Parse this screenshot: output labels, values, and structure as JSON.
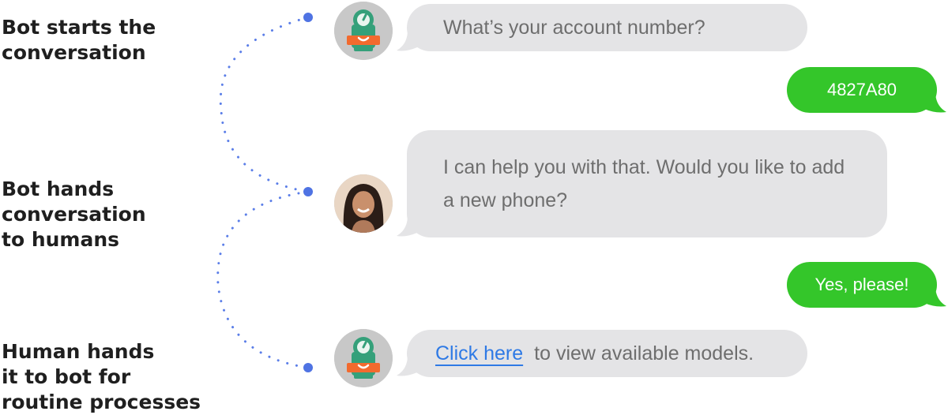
{
  "annotations": [
    {
      "id": "bot-starts",
      "text": "Bot starts the\nconversation"
    },
    {
      "id": "bot-hands",
      "text": "Bot hands\nconversation\nto humans"
    },
    {
      "id": "human-hands",
      "text": "Human hands\nit to bot for\nroutine processes"
    }
  ],
  "messages": [
    {
      "sender": "bot",
      "avatar": "bot-icon",
      "text": "What’s your account number?"
    },
    {
      "sender": "user",
      "text": "4827A80"
    },
    {
      "sender": "human-agent",
      "avatar": "agent-photo",
      "text": "I can help you with that. Would you like to add a new phone?"
    },
    {
      "sender": "user",
      "text": "Yes, please!"
    },
    {
      "sender": "bot",
      "avatar": "bot-icon",
      "link_text": "Click here",
      "text": "to view available models."
    }
  ],
  "colors": {
    "user_bubble": "#34c62a",
    "bot_bubble": "#e4e4e6",
    "link": "#2f7ae5",
    "flow_dots": "#5b7ee8",
    "bot_icon_body": "#35a07a",
    "bot_icon_accent": "#f26a2e"
  }
}
